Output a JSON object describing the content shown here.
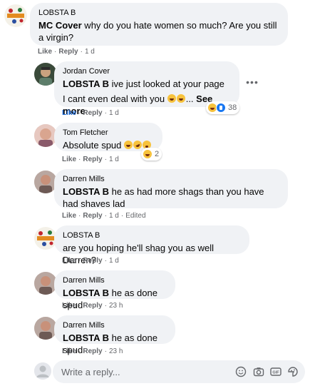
{
  "comments": [
    {
      "author": "LOBSTA B",
      "mention": "MC Cover",
      "text": " why do you hate women so much? Are you still a virgin?",
      "like": "Like",
      "reply": "Reply",
      "time": "1 d"
    },
    {
      "author": "Jordan Cover",
      "mention": "LOBSTA B",
      "text_line1": " ive just looked at your page",
      "text_line2": "I cant even deal with you ",
      "ellipsis": "...",
      "see_more": " See more",
      "like": "Like",
      "reply": "Reply",
      "time": "1 d",
      "liked": true,
      "reaction_count": "38"
    },
    {
      "author": "Tom Fletcher",
      "text": "Absolute spud ",
      "like": "Like",
      "reply": "Reply",
      "time": "1 d",
      "reaction_count": "2"
    },
    {
      "author": "Darren Mills",
      "mention": "LOBSTA B",
      "text": " he as had more shags than you have had shaves lad",
      "like": "Like",
      "reply": "Reply",
      "time": "1 d",
      "edited": "Edited"
    },
    {
      "author": "LOBSTA B",
      "text": "are you hoping he'll shag you as well Darren?",
      "like": "Like",
      "reply": "Reply",
      "time": "1 d"
    },
    {
      "author": "Darren Mills",
      "mention": "LOBSTA B",
      "text": " he as done spud",
      "like": "Like",
      "reply": "Reply",
      "time": "23 h"
    },
    {
      "author": "Darren Mills",
      "mention": "LOBSTA B",
      "text": " he as done spud",
      "like": "Like",
      "reply": "Reply",
      "time": "23 h"
    }
  ],
  "reply_box": {
    "placeholder": "Write a reply...",
    "icons": [
      "emoji-icon",
      "camera-icon",
      "gif-icon",
      "sticker-icon"
    ]
  },
  "colors": {
    "bubble": "#f0f2f5",
    "liked_blue": "#216fdb",
    "meta_gray": "#65676b"
  }
}
